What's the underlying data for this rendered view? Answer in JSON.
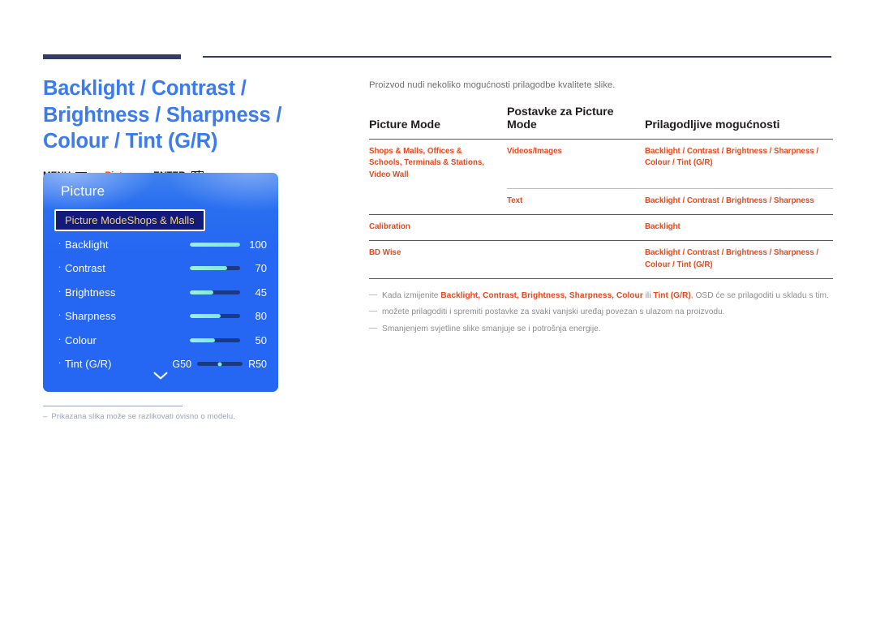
{
  "document": {
    "title": "Backlight / Contrast / Brightness / Sharpness / Colour / Tint (G/R)",
    "menu_path": {
      "menu_label": "MENU",
      "arrow1": "→",
      "picture_label": "Picture",
      "arrow2": "→",
      "enter_label": "ENTER"
    },
    "caption": {
      "dash": "–",
      "text": "Prikazana slika može se razlikovati ovisno o modelu."
    }
  },
  "osd": {
    "panel_title": "Picture",
    "selected_row": {
      "label": "Picture Mode",
      "value": "Shops & Malls"
    },
    "items": [
      {
        "bullet": "·",
        "name": "Backlight",
        "value": "100",
        "fill_pct": 100
      },
      {
        "bullet": "·",
        "name": "Contrast",
        "value": "70",
        "fill_pct": 74
      },
      {
        "bullet": "·",
        "name": "Brightness",
        "value": "45",
        "fill_pct": 46
      },
      {
        "bullet": "·",
        "name": "Sharpness",
        "value": "80",
        "fill_pct": 62
      },
      {
        "bullet": "·",
        "name": "Colour",
        "value": "50",
        "fill_pct": 50
      }
    ],
    "tint": {
      "bullet": "·",
      "name": "Tint (G/R)",
      "left_label": "G50",
      "right_label": "R50",
      "knob_pct": 50
    },
    "scroll_icon": "chevron-down"
  },
  "right": {
    "intro": "Proizvod nudi nekoliko mogućnosti prilagodbe kvalitete slike.",
    "table": {
      "headers": [
        "Picture Mode",
        "Postavke za Picture Mode",
        "Prilagodljive mogućnosti"
      ],
      "rows": [
        {
          "picture_mode": "Shops & Malls, Offices & Schools, Terminals & Stations, Video Wall",
          "settings": "Videos/Images",
          "options": "Backlight / Contrast / Brightness / Sharpness / Colour / Tint (G/R)",
          "divider": "full"
        },
        {
          "picture_mode": "",
          "settings": "Text",
          "options": "Backlight / Contrast / Brightness / Sharpness",
          "divider": "partial"
        },
        {
          "picture_mode": "Calibration",
          "settings": "",
          "options": "Backlight",
          "divider": "full"
        },
        {
          "picture_mode": "BD Wise",
          "settings": "",
          "options": "Backlight / Contrast / Brightness / Sharpness / Colour / Tint (G/R)",
          "divider": "full"
        }
      ]
    },
    "notes": [
      {
        "dash": "—",
        "pre": "Kada izmijenite ",
        "highlight": "Backlight, Contrast, Brightness, Sharpness, Colour",
        "mid": " ili ",
        "highlight2": "Tint (G/R)",
        "post": ", OSD će se prilagoditi u skladu s tim."
      },
      {
        "dash": "—",
        "pre": "možete prilagoditi i spremiti postavke za svaki vanjski uređaj povezan s ulazom na proizvodu.",
        "highlight": "",
        "mid": "",
        "highlight2": "",
        "post": ""
      },
      {
        "dash": "—",
        "pre": "Smanjenjem svjetline slike smanjuje se i potrošnja energije.",
        "highlight": "",
        "mid": "",
        "highlight2": "",
        "post": ""
      }
    ]
  },
  "colors": {
    "title_blue": "#3a7bf0",
    "accent_orange": "#e8481c",
    "navy": "#343d66",
    "osd_blue": "#2566f2",
    "osd_selected": "#141a7a",
    "osd_gold": "#f5d76e",
    "slider_fill": "#7fe8da"
  }
}
